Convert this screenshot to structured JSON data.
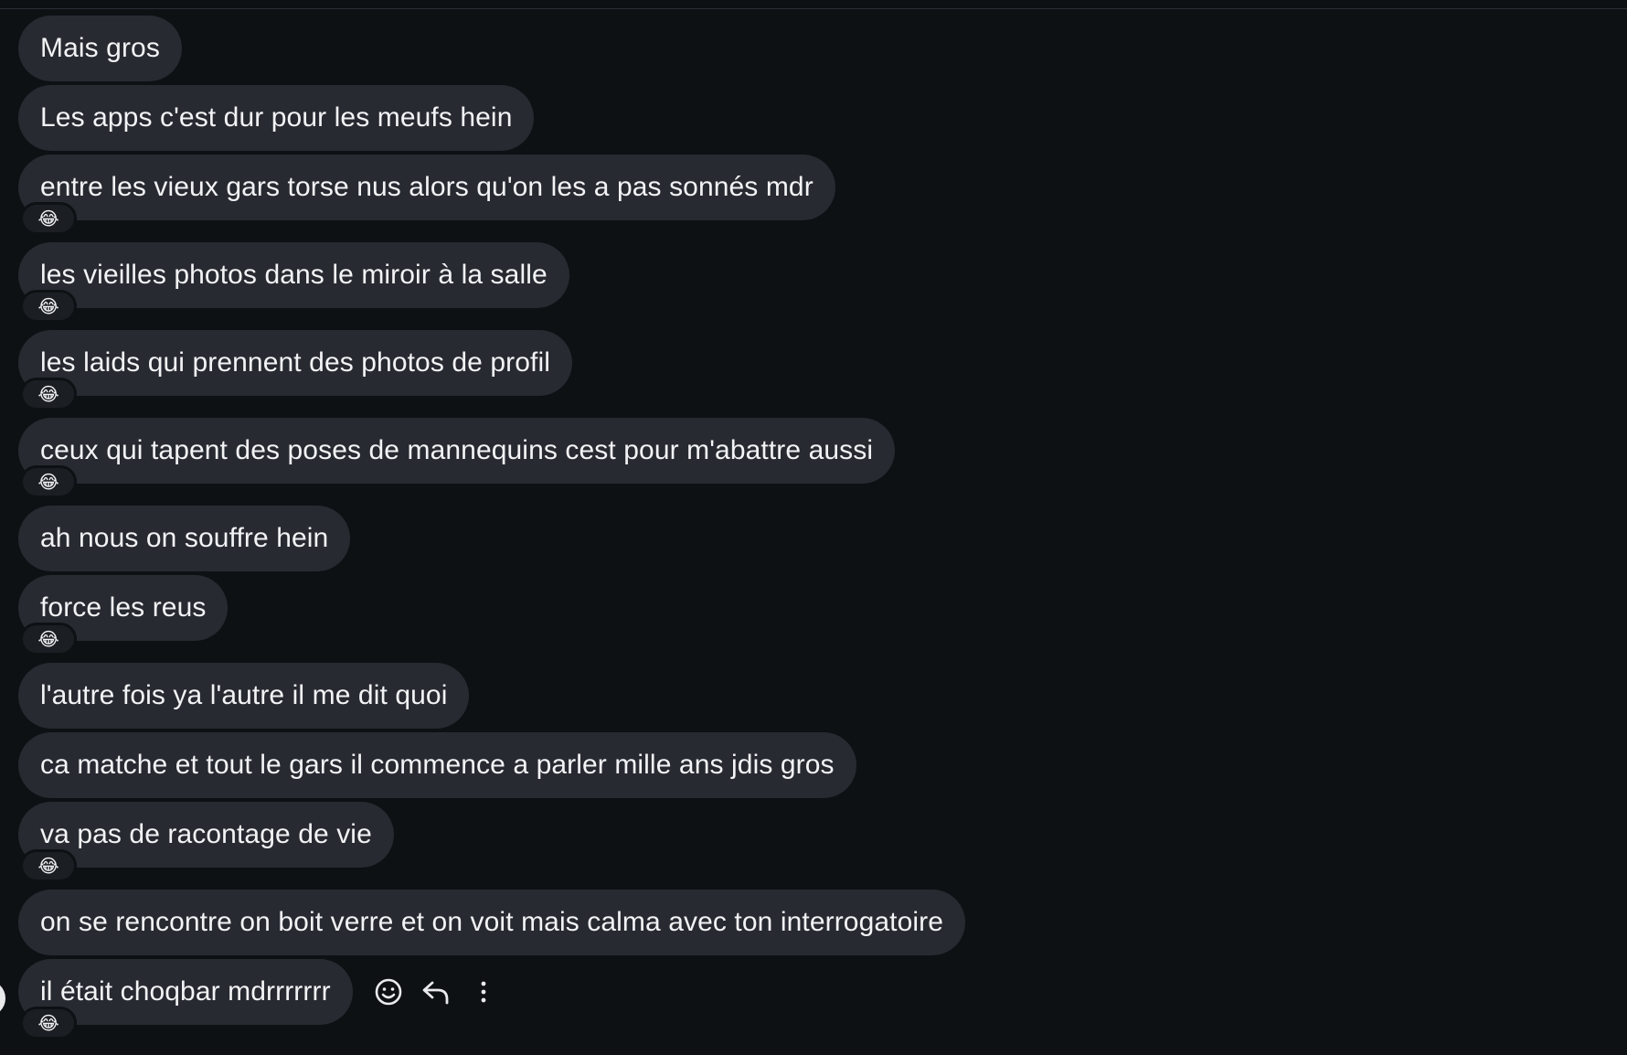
{
  "messages": [
    {
      "text": "Mais gros",
      "reaction": ""
    },
    {
      "text": "Les apps c'est dur pour les meufs hein",
      "reaction": ""
    },
    {
      "text": "entre les vieux gars torse nus alors qu'on les a pas sonnés mdr",
      "reaction": "😂"
    },
    {
      "text": "les vieilles photos dans le miroir à la salle",
      "reaction": "😂"
    },
    {
      "text": "les laids qui prennent des photos de profil",
      "reaction": "😂"
    },
    {
      "text": "ceux qui tapent des poses de mannequins cest pour m'abattre aussi",
      "reaction": "😂"
    },
    {
      "text": "ah nous on souffre hein",
      "reaction": ""
    },
    {
      "text": "force les reus",
      "reaction": "😂"
    },
    {
      "text": "l'autre fois ya l'autre il me dit quoi",
      "reaction": ""
    },
    {
      "text": "ca matche et tout le gars il commence a parler mille ans jdis gros",
      "reaction": ""
    },
    {
      "text": "va pas de racontage de vie",
      "reaction": "😂"
    },
    {
      "text": "on se rencontre on boit verre et on voit mais calma avec ton interrogatoire",
      "reaction": ""
    },
    {
      "text": "il était choqbar mdrrrrrrr",
      "reaction": "😂"
    }
  ],
  "hover_actions": {
    "icons": [
      "smiley-icon",
      "reply-icon",
      "more-icon"
    ]
  },
  "colors": {
    "background": "#0e1114",
    "bubble": "#272a31",
    "text": "#f2f3f5"
  }
}
